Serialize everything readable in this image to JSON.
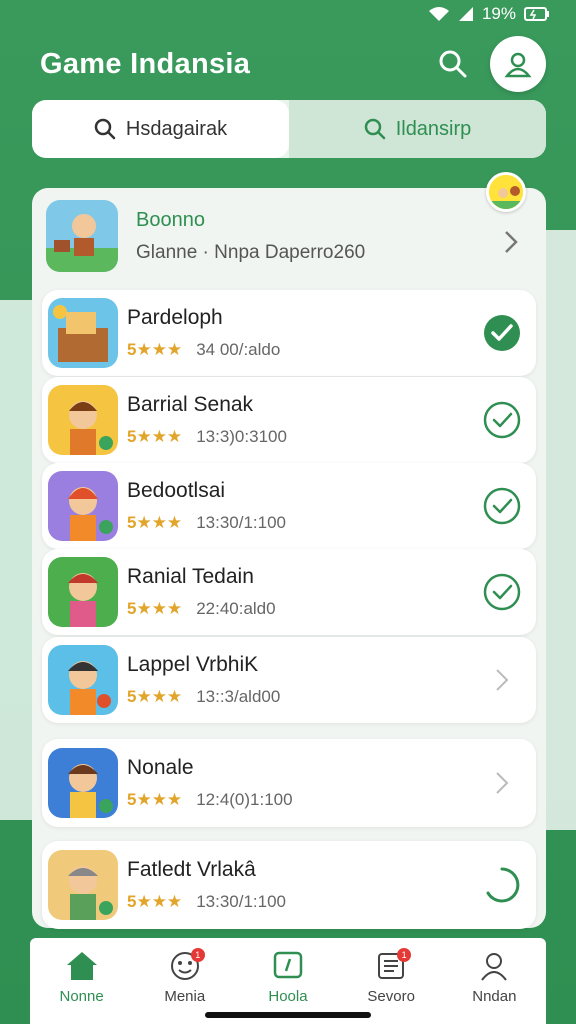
{
  "status": {
    "battery": "19%"
  },
  "header": {
    "title": "Game Indansia"
  },
  "tabs": [
    {
      "label": "Hsdagairak",
      "active": true
    },
    {
      "label": "Ildansirp",
      "active": false
    }
  ],
  "featured": {
    "title": "Boonno",
    "subtitle": "Glanne · Nnpa Daperro260"
  },
  "games": [
    {
      "name": "Pardeloph",
      "rating": "5★★★",
      "detail": "34 00/:aldo",
      "status": "installed"
    },
    {
      "name": "Barrial Senak",
      "rating": "5★★★",
      "detail": "13:3)0:3100",
      "status": "check"
    },
    {
      "name": "Bedootlsai",
      "rating": "5★★★",
      "detail": "13:30/1:100",
      "status": "check"
    },
    {
      "name": "Ranial Tedain",
      "rating": "5★★★",
      "detail": "22:40:ald0",
      "status": "check"
    },
    {
      "name": "Lappel VrbhiK",
      "rating": "5★★★",
      "detail": "13::3/ald00",
      "status": "chevron"
    },
    {
      "name": "Nonale",
      "rating": "5★★★",
      "detail": "12:4(0)1:100",
      "status": "chevron"
    },
    {
      "name": "Fatledt Vrlakâ",
      "rating": "5★★★",
      "detail": "13:30/1:100",
      "status": "loading"
    }
  ],
  "nav": [
    {
      "label": "Nonne",
      "icon": "home-icon",
      "active": true
    },
    {
      "label": "Menia",
      "icon": "face-icon",
      "badge": "1"
    },
    {
      "label": "Hoola",
      "icon": "chat-icon"
    },
    {
      "label": "Sevoro",
      "icon": "list-icon",
      "badge": "1"
    },
    {
      "label": "Nndan",
      "icon": "user-icon"
    }
  ],
  "colors": {
    "brand": "#2f8f52",
    "star": "#e2a52b",
    "bg_light": "#f1f5f2"
  }
}
